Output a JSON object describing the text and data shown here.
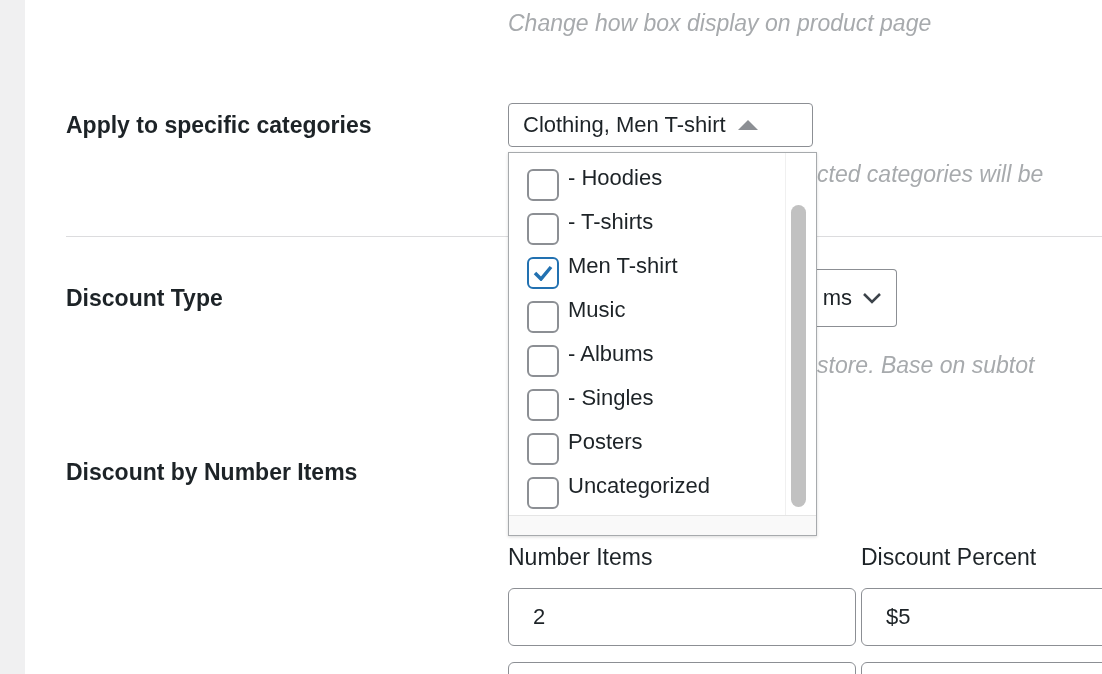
{
  "top_hint": "Change how box display on product page",
  "categories": {
    "label": "Apply to specific categories",
    "value": "Clothing, Men T-shirt",
    "expanded": true,
    "hint": "cted categories will be",
    "options": [
      {
        "label": "- Hoodies",
        "checked": false
      },
      {
        "label": "- T-shirts",
        "checked": false
      },
      {
        "label": "Men T-shirt",
        "checked": true
      },
      {
        "label": "Music",
        "checked": false
      },
      {
        "label": "- Albums",
        "checked": false
      },
      {
        "label": "- Singles",
        "checked": false
      },
      {
        "label": "Posters",
        "checked": false
      },
      {
        "label": "Uncategorized",
        "checked": false
      }
    ]
  },
  "discount_type": {
    "label": "Discount Type",
    "value": "ms",
    "hint": "store. Base on subtot"
  },
  "discount_by_items": {
    "label": "Discount by Number Items",
    "columns": [
      "Number Items",
      "Discount Percent"
    ],
    "rows": [
      {
        "cells": [
          "2",
          "$5"
        ]
      }
    ]
  }
}
